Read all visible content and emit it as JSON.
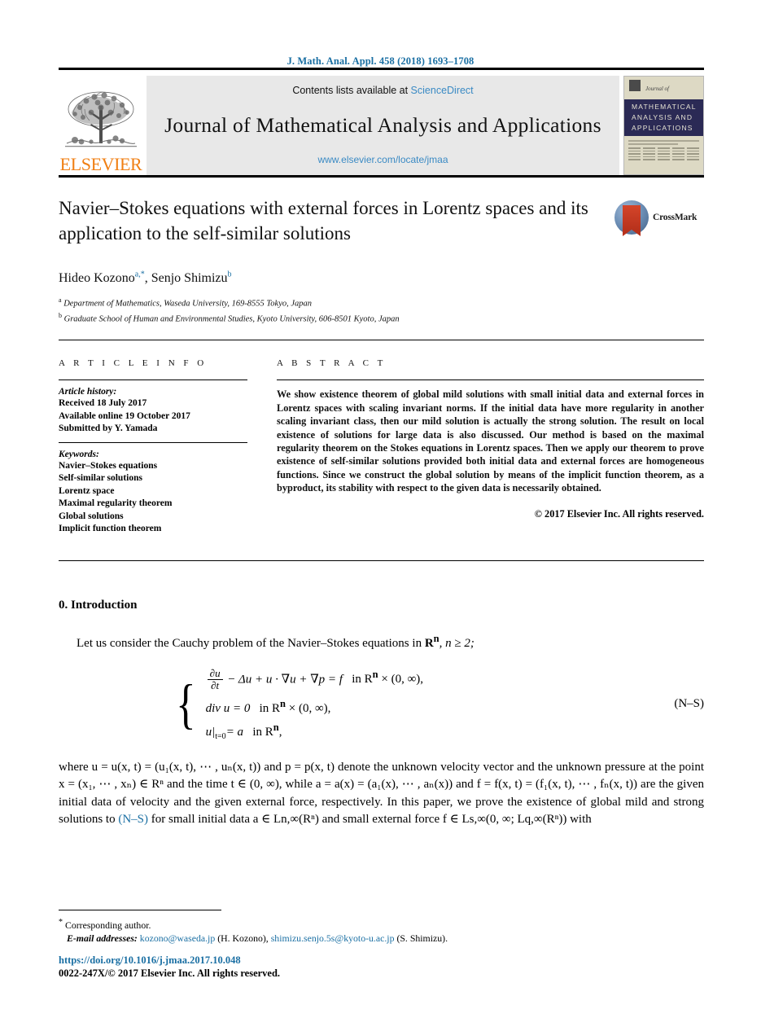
{
  "running_head": "J. Math. Anal. Appl. 458 (2018) 1693–1708",
  "masthead": {
    "contents_prefix": "Contents lists available at ",
    "sciencedirect": "ScienceDirect",
    "journal_title": "Journal of Mathematical Analysis and Applications",
    "journal_url": "www.elsevier.com/locate/jmaa",
    "publisher_wordmark": "ELSEVIER",
    "cover": {
      "journal_of": "Journal of",
      "band_line1": "MATHEMATICAL",
      "band_line2": "ANALYSIS AND",
      "band_line3": "APPLICATIONS"
    }
  },
  "article": {
    "title": "Navier–Stokes equations with external forces in Lorentz spaces and its application to the self-similar solutions",
    "crossmark_label": "CrossMark",
    "authors_html": "Hideo Kozono<sup>a,*</sup>, Senjo Shimizu<sup>b</sup>",
    "affiliation_a": "Department of Mathematics, Waseda University, 169-8555 Tokyo, Japan",
    "affiliation_b": "Graduate School of Human and Environmental Studies, Kyoto University, 606-8501 Kyoto, Japan",
    "affil_a_marker": "a",
    "affil_b_marker": "b"
  },
  "info": {
    "heading": "A R T I C L E   I N F O",
    "history_title": "Article history:",
    "history": [
      "Received 18 July 2017",
      "Available online 19 October 2017",
      "Submitted by Y. Yamada"
    ],
    "keywords_title": "Keywords:",
    "keywords": [
      "Navier–Stokes equations",
      "Self-similar solutions",
      "Lorentz space",
      "Maximal regularity theorem",
      "Global solutions",
      "Implicit function theorem"
    ]
  },
  "abstract": {
    "heading": "A B S T R A C T",
    "text": "We show existence theorem of global mild solutions with small initial data and external forces in Lorentz spaces with scaling invariant norms. If the initial data have more regularity in another scaling invariant class, then our mild solution is actually the strong solution. The result on local existence of solutions for large data is also discussed. Our method is based on the maximal regularity theorem on the Stokes equations in Lorentz spaces. Then we apply our theorem to prove existence of self-similar solutions provided both initial data and external forces are homogeneous functions. Since we construct the global solution by means of the implicit function theorem, as a byproduct, its stability with respect to the given data is necessarily obtained.",
    "copyright": "© 2017 Elsevier Inc. All rights reserved."
  },
  "body": {
    "section_number": "0.",
    "section_title": "Introduction",
    "intro_lead": "Let us consider the Cauchy problem of the Navier–Stokes equations in",
    "intro_lead_math": "R",
    "intro_lead_sup": "n",
    "intro_lead_tail": ", n ≥ 2;",
    "equation": {
      "tag": "(N–S)",
      "line1_num": "∂u",
      "line1_den": "∂t",
      "line1_rest": "− Δu + u · ∇u + ∇p = f",
      "line1_domain": "in R",
      "line1_domain_sup": "n",
      "line1_domain_tail": "× (0, ∞),",
      "line2": "div u = 0",
      "line2_domain": "in R",
      "line2_domain_sup": "n",
      "line2_domain_tail": "× (0, ∞),",
      "line3": "u|",
      "line3_sub": "t=0",
      "line3_rest": "= a",
      "line3_domain": "in R",
      "line3_domain_sup": "n",
      "line3_domain_tail": ","
    },
    "paragraph_2_part1": "where u = u(x,t) = (u",
    "paragraph_2": "where u = u(x, t) = (u₁(x, t), ⋯ , uₙ(x, t)) and p = p(x, t) denote the unknown velocity vector and the unknown pressure at the point x = (x₁, ⋯ , xₙ) ∈ Rⁿ and the time t ∈ (0, ∞), while a = a(x) = (a₁(x), ⋯ , aₙ(x)) and f = f(x, t) = (f₁(x, t), ⋯ , fₙ(x, t)) are the given initial data of velocity and the given external force, respectively. In this paper, we prove the existence of global mild and strong solutions to (N–S) for small initial data a ∈ Ln,∞(Rⁿ) and small external force f ∈ Ls,∞(0, ∞; Lq,∞(Rⁿ)) with",
    "equation_ref": "(N–S)"
  },
  "footer": {
    "corresponding_marker": "*",
    "corresponding": "Corresponding author.",
    "email_label": "E-mail addresses:",
    "email1": "kozono@waseda.jp",
    "email1_who": "(H. Kozono),",
    "email2": "shimizu.senjo.5s@kyoto-u.ac.jp",
    "email2_who": "(S. Shimizu).",
    "doi": "https://doi.org/10.1016/j.jmaa.2017.10.048",
    "issn_line": "0022-247X/© 2017 Elsevier Inc. All rights reserved."
  },
  "colors": {
    "link_blue": "#1a6fa3",
    "sciencedirect_blue": "#3a8ac4",
    "elsevier_orange": "#f07f13",
    "cover_navy": "#2b2a55"
  }
}
